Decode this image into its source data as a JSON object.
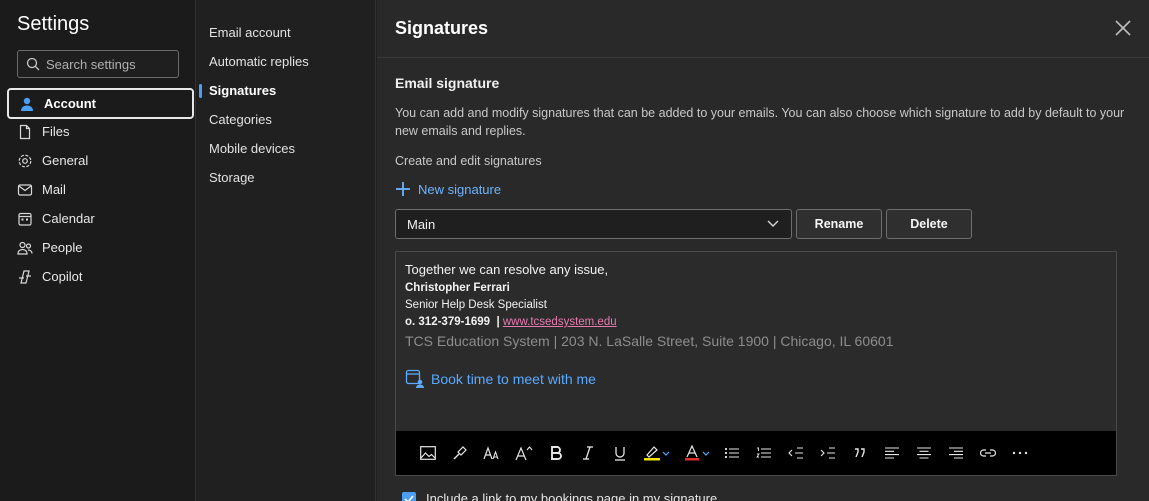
{
  "app": {
    "title": "Settings"
  },
  "search": {
    "placeholder": "Search settings"
  },
  "nav": [
    {
      "label": "Account",
      "icon": "person-icon",
      "active": true
    },
    {
      "label": "Files",
      "icon": "file-icon"
    },
    {
      "label": "General",
      "icon": "gear-icon"
    },
    {
      "label": "Mail",
      "icon": "mail-icon"
    },
    {
      "label": "Calendar",
      "icon": "calendar-icon"
    },
    {
      "label": "People",
      "icon": "people-icon"
    },
    {
      "label": "Copilot",
      "icon": "copilot-icon"
    }
  ],
  "subnav": [
    {
      "label": "Email account"
    },
    {
      "label": "Automatic replies"
    },
    {
      "label": "Signatures",
      "active": true
    },
    {
      "label": "Categories"
    },
    {
      "label": "Mobile devices"
    },
    {
      "label": "Storage"
    }
  ],
  "page": {
    "title": "Signatures",
    "section_title": "Email signature",
    "description": "You can add and modify signatures that can be added to your emails. You can also choose which signature to add by default to your new emails and replies.",
    "create_label": "Create and edit signatures",
    "new_signature": "New signature",
    "selected_signature": "Main",
    "rename": "Rename",
    "delete": "Delete"
  },
  "signature": {
    "line1": "Together we can resolve any issue,",
    "name": "Christopher Ferrari",
    "role": "Senior Help Desk Specialist",
    "phone": "o. 312-379-1699",
    "separator": "|",
    "website": "www.tcsedsystem.edu",
    "address": "TCS Education System | 203 N. LaSalle Street, Suite 1900 | Chicago, IL 60601",
    "booking": "Book time to meet with me"
  },
  "bottom": {
    "checkbox_label": "Include a link to my bookings page in my signature"
  },
  "colors": {
    "accent": "#4a9ff5",
    "link": "#6cb4ff",
    "website_link": "#e67ab0"
  }
}
